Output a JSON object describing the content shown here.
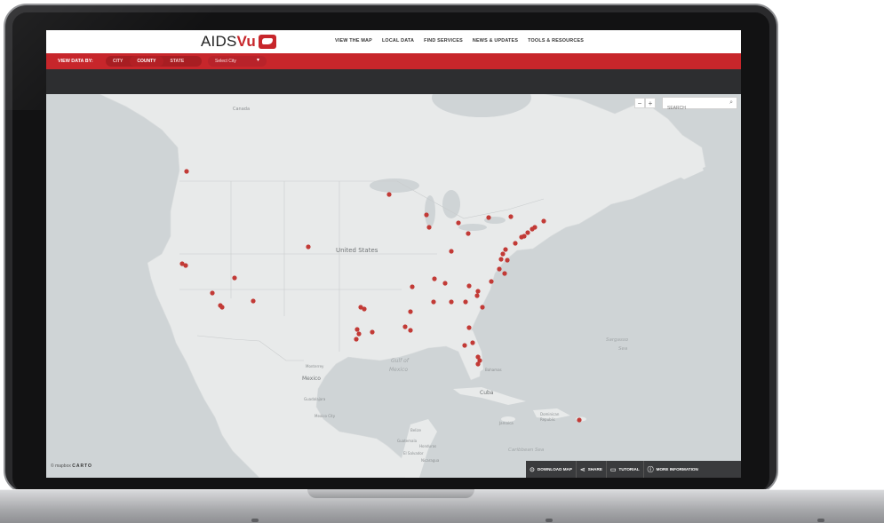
{
  "logo": {
    "text_aids": "AIDS",
    "text_vu": "Vu"
  },
  "nav": [
    "VIEW THE MAP",
    "LOCAL DATA",
    "FIND SERVICES",
    "NEWS & UPDATES",
    "TOOLS & RESOURCES"
  ],
  "filter": {
    "label": "VIEW DATA BY:",
    "options": [
      "CITY",
      "COUNTY",
      "STATE"
    ],
    "selected": "COUNTY",
    "select_value": "Select City",
    "caret": "▾"
  },
  "map_controls": {
    "zoom_out": "−",
    "zoom_in": "+",
    "search_placeholder": "SEARCH"
  },
  "map_labels": {
    "canada": "Canada",
    "us": "United States",
    "mexico_country": "Mexico",
    "gulf": "Gulf of",
    "gulf2": "Mexico",
    "cuba": "Cuba",
    "sargasso": "Sargasso",
    "sea": "Sea",
    "caribbean": "Caribbean Sea",
    "monterrey": "Monterrey",
    "mexico_city": "Mexico City",
    "guadalajara": "Guadalajara",
    "dominican": "Dominican",
    "republic": "Republic",
    "jamaica": "Jamaica",
    "bahamas": "Bahamas",
    "guatemala": "Guatemala",
    "honduras": "Honduras",
    "el_salvador": "El Salvador",
    "nicaragua": "Nicaragua",
    "belize": "Belize"
  },
  "attribution": {
    "mapbox": "© mapbox",
    "carto": "CARTO"
  },
  "toolbar": {
    "download": "DOWNLOAD MAP",
    "share": "SHARE",
    "tutorial": "TUTORIAL",
    "more_info": "MORE INFORMATION"
  },
  "colors": {
    "accent": "#c7262b",
    "marker": "#c23a36",
    "land": "#e8eaea",
    "water": "#cfd4d6"
  }
}
